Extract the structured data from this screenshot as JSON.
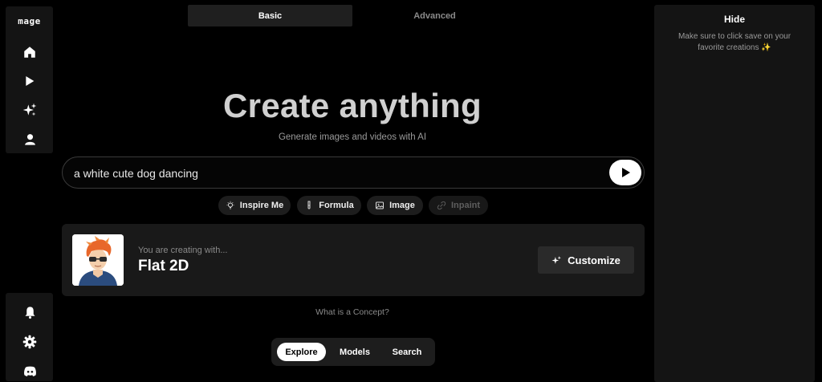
{
  "sidebar": {
    "logo": "mage",
    "nav_icons": [
      "home-icon",
      "play-icon",
      "sparkles-icon",
      "user-icon"
    ],
    "bottom_icons": [
      "bell-icon",
      "gear-icon",
      "discord-icon"
    ]
  },
  "mode_tabs": {
    "basic": "Basic",
    "advanced": "Advanced",
    "active": "Basic"
  },
  "hero": {
    "title": "Create anything",
    "subtitle": "Generate images and videos with AI"
  },
  "prompt": {
    "value": "a white cute dog dancing",
    "submit_icon": "play-icon"
  },
  "chips": [
    {
      "label": "Inspire Me",
      "icon": "lightbulb-icon",
      "enabled": true
    },
    {
      "label": "Formula",
      "icon": "test-tube-icon",
      "enabled": true
    },
    {
      "label": "Image",
      "icon": "image-icon",
      "enabled": true
    },
    {
      "label": "Inpaint",
      "icon": "link-icon",
      "enabled": false
    }
  ],
  "concept": {
    "label": "You are creating with...",
    "name": "Flat 2D",
    "customize_label": "Customize",
    "link": "What is a Concept?"
  },
  "bottom_tabs": {
    "items": [
      "Explore",
      "Models",
      "Search"
    ],
    "active": "Explore"
  },
  "right_panel": {
    "hide_label": "Hide",
    "note": "Make sure to click save on your favorite creations ✨"
  },
  "colors": {
    "background": "#000000",
    "panel": "#141414",
    "accent": "#ffffff"
  }
}
